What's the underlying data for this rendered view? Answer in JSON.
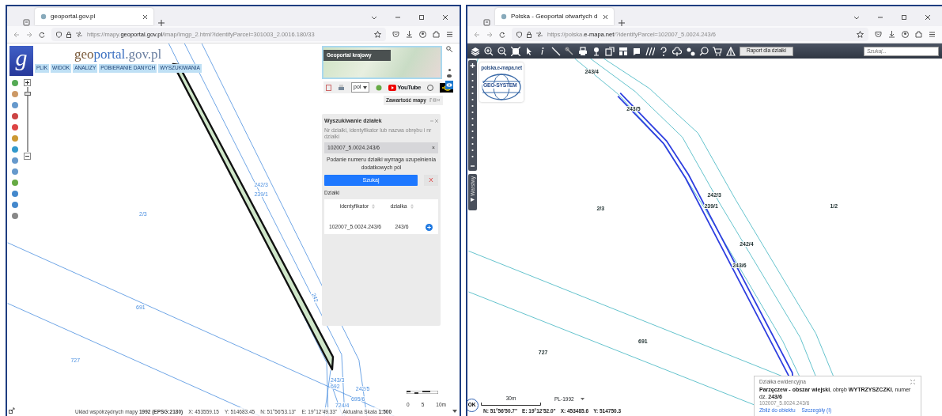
{
  "left_browser": {
    "tabs": [
      {
        "title": "geoportal.gov.pl",
        "selected": true
      }
    ],
    "url": {
      "prefix": "https://mapy.",
      "domain": "geoportal.gov.pl",
      "path": "/imap/Imgp_2.html?identifyParcel=301003_2.0016.180/33"
    },
    "app": {
      "logo_letter": "g",
      "site_title_parts": [
        "geo",
        "portal",
        ".gov.pl"
      ],
      "menu": [
        "PLIK",
        "WIDOK",
        "ANALIZY",
        "POBIERANIE DANYCH",
        "WYSZUKIWANIA"
      ],
      "zoom_slider": {
        "level": 0.92
      },
      "overview_label": "Geoportal krajowy",
      "language": "pol",
      "youtube_label": "YouTube",
      "map_content_button": "Zawartość mapy",
      "search_panel": {
        "title": "Wyszukiwanie działek",
        "hint": "Nr działki, identyfikator lub nazwa obrębu i nr działki",
        "value": "102007_5.0024.243/6",
        "clear": "×",
        "note": "Podanie numeru działki wymaga uzupełnienia dodatkowych pól",
        "search_button": "Szukaj",
        "cancel": "X",
        "results_label": "Działki",
        "columns": [
          "identyfikator",
          "działka"
        ],
        "rows": [
          [
            "102007_5.0024.243/6",
            "243/6"
          ]
        ]
      },
      "map_labels": [
        "2/3",
        "242/3",
        "239/1",
        "242",
        "691",
        "727",
        "243/3",
        "692",
        "242/5",
        "695/6",
        "724/4"
      ],
      "scale_labels": [
        "0",
        "5",
        "10m"
      ],
      "status": {
        "crs": "Układ współrzędnych mapy **1992 (EPSG:2180)**",
        "x": "X: 453559.15",
        "y": "Y: 514683.45",
        "n": "N: 51°56'53.13\"",
        "e": "E: 19°12'49.33\"",
        "scale": "Aktualna Skala **1:500**"
      }
    }
  },
  "right_browser": {
    "tabs": [
      {
        "title": "Polska - Geoportal otwartych d",
        "selected": true
      }
    ],
    "url": {
      "prefix": "https://polska.",
      "domain": "e-mapa.net",
      "path": "/?identifyParcel=102007_5.0024.243/6"
    },
    "app": {
      "report_button": "Raport dla działki",
      "search_placeholder": "Szukaj...",
      "logo_site": "polska.e-mapa.net",
      "logo_name": "GEO-SYSTEM",
      "layers_tab": "Warstwy",
      "map_labels": [
        "243/4",
        "243/5",
        "242/3",
        "239/1",
        "2/3",
        "1/2",
        "242/4",
        "243/6",
        "691",
        "727"
      ],
      "popup": {
        "title": "Działka ewidencyjna",
        "description": "**Parzęczew - obszar wiejski**, obręb **WYTRZYSZCZKI**, numer dz. **243/6**",
        "id": "102007_5.0024.243/6",
        "links": [
          "Zbliż do obiektu",
          "Szczegóły (I)"
        ]
      },
      "ok_button": "OK",
      "scale_label": "30m",
      "crs": "PL-1992",
      "coords": [
        "N: 51°56'50.7\"",
        "E: 19°12'52.0\"",
        "X: 453485.6",
        "Y: 514750.3"
      ]
    }
  }
}
